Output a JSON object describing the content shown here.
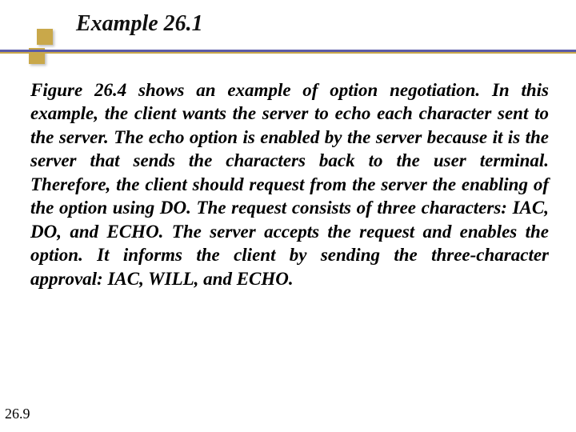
{
  "title": "Example 26.1",
  "body": "Figure 26.4 shows an example of option negotiation. In this example, the client wants the server to echo each character sent to the server. The echo option is enabled by the server because it is the server that sends the characters back to the user terminal. Therefore, the client should request from the server the enabling of the option using DO. The request consists of three characters: IAC, DO, and ECHO. The server accepts the request and enables the option. It informs the client by sending the three-character approval: IAC, WILL, and ECHO.",
  "page_number": "26.9"
}
